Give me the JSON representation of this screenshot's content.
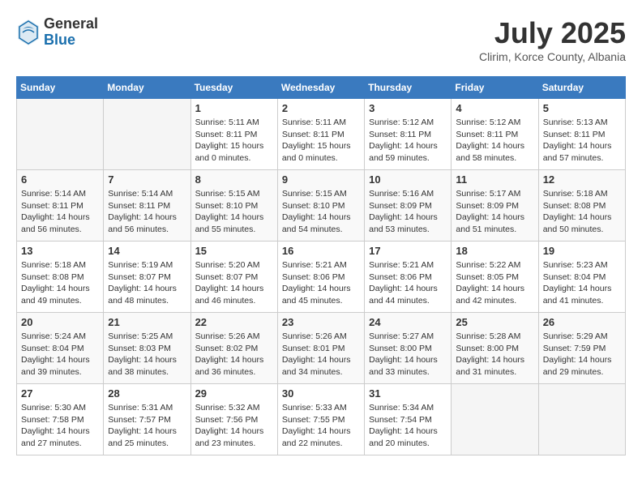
{
  "header": {
    "logo_general": "General",
    "logo_blue": "Blue",
    "month": "July 2025",
    "location": "Clirim, Korce County, Albania"
  },
  "weekdays": [
    "Sunday",
    "Monday",
    "Tuesday",
    "Wednesday",
    "Thursday",
    "Friday",
    "Saturday"
  ],
  "weeks": [
    [
      {
        "day": "",
        "info": ""
      },
      {
        "day": "",
        "info": ""
      },
      {
        "day": "1",
        "info": "Sunrise: 5:11 AM\nSunset: 8:11 PM\nDaylight: 15 hours\nand 0 minutes."
      },
      {
        "day": "2",
        "info": "Sunrise: 5:11 AM\nSunset: 8:11 PM\nDaylight: 15 hours\nand 0 minutes."
      },
      {
        "day": "3",
        "info": "Sunrise: 5:12 AM\nSunset: 8:11 PM\nDaylight: 14 hours\nand 59 minutes."
      },
      {
        "day": "4",
        "info": "Sunrise: 5:12 AM\nSunset: 8:11 PM\nDaylight: 14 hours\nand 58 minutes."
      },
      {
        "day": "5",
        "info": "Sunrise: 5:13 AM\nSunset: 8:11 PM\nDaylight: 14 hours\nand 57 minutes."
      }
    ],
    [
      {
        "day": "6",
        "info": "Sunrise: 5:14 AM\nSunset: 8:11 PM\nDaylight: 14 hours\nand 56 minutes."
      },
      {
        "day": "7",
        "info": "Sunrise: 5:14 AM\nSunset: 8:11 PM\nDaylight: 14 hours\nand 56 minutes."
      },
      {
        "day": "8",
        "info": "Sunrise: 5:15 AM\nSunset: 8:10 PM\nDaylight: 14 hours\nand 55 minutes."
      },
      {
        "day": "9",
        "info": "Sunrise: 5:15 AM\nSunset: 8:10 PM\nDaylight: 14 hours\nand 54 minutes."
      },
      {
        "day": "10",
        "info": "Sunrise: 5:16 AM\nSunset: 8:09 PM\nDaylight: 14 hours\nand 53 minutes."
      },
      {
        "day": "11",
        "info": "Sunrise: 5:17 AM\nSunset: 8:09 PM\nDaylight: 14 hours\nand 51 minutes."
      },
      {
        "day": "12",
        "info": "Sunrise: 5:18 AM\nSunset: 8:08 PM\nDaylight: 14 hours\nand 50 minutes."
      }
    ],
    [
      {
        "day": "13",
        "info": "Sunrise: 5:18 AM\nSunset: 8:08 PM\nDaylight: 14 hours\nand 49 minutes."
      },
      {
        "day": "14",
        "info": "Sunrise: 5:19 AM\nSunset: 8:07 PM\nDaylight: 14 hours\nand 48 minutes."
      },
      {
        "day": "15",
        "info": "Sunrise: 5:20 AM\nSunset: 8:07 PM\nDaylight: 14 hours\nand 46 minutes."
      },
      {
        "day": "16",
        "info": "Sunrise: 5:21 AM\nSunset: 8:06 PM\nDaylight: 14 hours\nand 45 minutes."
      },
      {
        "day": "17",
        "info": "Sunrise: 5:21 AM\nSunset: 8:06 PM\nDaylight: 14 hours\nand 44 minutes."
      },
      {
        "day": "18",
        "info": "Sunrise: 5:22 AM\nSunset: 8:05 PM\nDaylight: 14 hours\nand 42 minutes."
      },
      {
        "day": "19",
        "info": "Sunrise: 5:23 AM\nSunset: 8:04 PM\nDaylight: 14 hours\nand 41 minutes."
      }
    ],
    [
      {
        "day": "20",
        "info": "Sunrise: 5:24 AM\nSunset: 8:04 PM\nDaylight: 14 hours\nand 39 minutes."
      },
      {
        "day": "21",
        "info": "Sunrise: 5:25 AM\nSunset: 8:03 PM\nDaylight: 14 hours\nand 38 minutes."
      },
      {
        "day": "22",
        "info": "Sunrise: 5:26 AM\nSunset: 8:02 PM\nDaylight: 14 hours\nand 36 minutes."
      },
      {
        "day": "23",
        "info": "Sunrise: 5:26 AM\nSunset: 8:01 PM\nDaylight: 14 hours\nand 34 minutes."
      },
      {
        "day": "24",
        "info": "Sunrise: 5:27 AM\nSunset: 8:00 PM\nDaylight: 14 hours\nand 33 minutes."
      },
      {
        "day": "25",
        "info": "Sunrise: 5:28 AM\nSunset: 8:00 PM\nDaylight: 14 hours\nand 31 minutes."
      },
      {
        "day": "26",
        "info": "Sunrise: 5:29 AM\nSunset: 7:59 PM\nDaylight: 14 hours\nand 29 minutes."
      }
    ],
    [
      {
        "day": "27",
        "info": "Sunrise: 5:30 AM\nSunset: 7:58 PM\nDaylight: 14 hours\nand 27 minutes."
      },
      {
        "day": "28",
        "info": "Sunrise: 5:31 AM\nSunset: 7:57 PM\nDaylight: 14 hours\nand 25 minutes."
      },
      {
        "day": "29",
        "info": "Sunrise: 5:32 AM\nSunset: 7:56 PM\nDaylight: 14 hours\nand 23 minutes."
      },
      {
        "day": "30",
        "info": "Sunrise: 5:33 AM\nSunset: 7:55 PM\nDaylight: 14 hours\nand 22 minutes."
      },
      {
        "day": "31",
        "info": "Sunrise: 5:34 AM\nSunset: 7:54 PM\nDaylight: 14 hours\nand 20 minutes."
      },
      {
        "day": "",
        "info": ""
      },
      {
        "day": "",
        "info": ""
      }
    ]
  ]
}
